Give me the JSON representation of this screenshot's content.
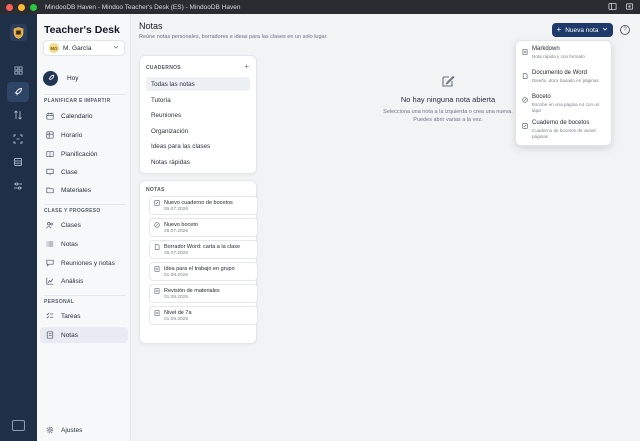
{
  "window": {
    "title": "MindooDB Haven - Mindoo Teacher's Desk (ES) - MindooDB Haven",
    "traffic_colors": [
      "#fe5f57",
      "#febc2e",
      "#28c840"
    ]
  },
  "rail": {
    "items": [
      {
        "icon": "dashboard-icon",
        "active": false
      },
      {
        "icon": "rocket-icon",
        "active": true
      },
      {
        "icon": "sync-arrows-icon",
        "active": false
      },
      {
        "icon": "focus-icon",
        "active": false
      },
      {
        "icon": "database-icon",
        "active": false
      },
      {
        "icon": "sliders-icon",
        "active": false
      }
    ]
  },
  "sidebar": {
    "brand_prefix": "Teacher's ",
    "brand_suffix": "Desk",
    "user": {
      "initials": "MG",
      "name": "M. García"
    },
    "today_label": "Hoy",
    "plan_section": "PLANIFICAR E IMPARTIR",
    "plan_items": [
      {
        "label": "Calendario",
        "icon": "calendar-icon"
      },
      {
        "label": "Horario",
        "icon": "schedule-icon"
      },
      {
        "label": "Planificación",
        "icon": "book-icon"
      },
      {
        "label": "Clase",
        "icon": "presentation-icon"
      },
      {
        "label": "Materiales",
        "icon": "folder-icon"
      }
    ],
    "progress_section": "CLASE Y PROGRESO",
    "progress_items": [
      {
        "label": "Clases",
        "icon": "users-icon"
      },
      {
        "label": "Notas",
        "icon": "list-icon"
      },
      {
        "label": "Reuniones y notas",
        "icon": "chat-icon"
      },
      {
        "label": "Análisis",
        "icon": "chart-icon"
      }
    ],
    "personal_section": "PERSONAL",
    "personal_items": [
      {
        "label": "Tareas",
        "icon": "checklist-icon",
        "active": false
      },
      {
        "label": "Notas",
        "icon": "notebook-icon",
        "active": true
      }
    ],
    "settings_label": "Ajustes"
  },
  "main": {
    "title": "Notas",
    "subtitle": "Reúne notas personales, borradores e ideas para las clases en un solo lugar.",
    "new_button": "Nueva nota",
    "help": "?",
    "notebooks_header": "CUADERNOS",
    "notebooks_add": "+",
    "notebooks": [
      {
        "label": "Todas las notas",
        "active": true
      },
      {
        "label": "Tutoría",
        "active": false
      },
      {
        "label": "Reuniones",
        "active": false
      },
      {
        "label": "Organización",
        "active": false
      },
      {
        "label": "Ideas para las clases",
        "active": false
      },
      {
        "label": "Notas rápidas",
        "active": false
      }
    ],
    "notes_header": "NOTAS",
    "notes": [
      {
        "title": "Nuevo cuaderno de bocetos",
        "date": "26.07.2026",
        "icon": "sketchbook-icon"
      },
      {
        "title": "Nuevo boceto",
        "date": "26.07.2026",
        "icon": "sketch-icon"
      },
      {
        "title": "Borrador Word: carta a la clase",
        "date": "26.07.2026",
        "icon": "document-icon"
      },
      {
        "title": "Idea para el trabajo en grupo",
        "date": "01.08.2026",
        "icon": "markdown-icon"
      },
      {
        "title": "Revisión de materiales",
        "date": "01.08.2025",
        "icon": "markdown-icon"
      },
      {
        "title": "Nivel de 7a",
        "date": "01.08.2025",
        "icon": "markdown-icon"
      }
    ],
    "empty_title": "No hay ninguna nota abierta",
    "empty_text_1": "Selecciona una nota a la izquierda o crea una nueva.",
    "empty_text_2": "Puedes abrir varias a la vez."
  },
  "dropdown": {
    "items": [
      {
        "title": "Markdown",
        "desc": "Nota rápida y con formato",
        "icon": "markdown-icon"
      },
      {
        "title": "Documento de Word",
        "desc": "Diseño .docx basado en páginas",
        "icon": "document-icon"
      },
      {
        "title": "Boceto",
        "desc": "Escribe en una página A4 con un lápiz",
        "icon": "sketch-icon"
      },
      {
        "title": "Cuaderno de bocetos",
        "desc": "Cuaderno de bocetos de varias páginas",
        "icon": "sketchbook-icon"
      }
    ]
  }
}
